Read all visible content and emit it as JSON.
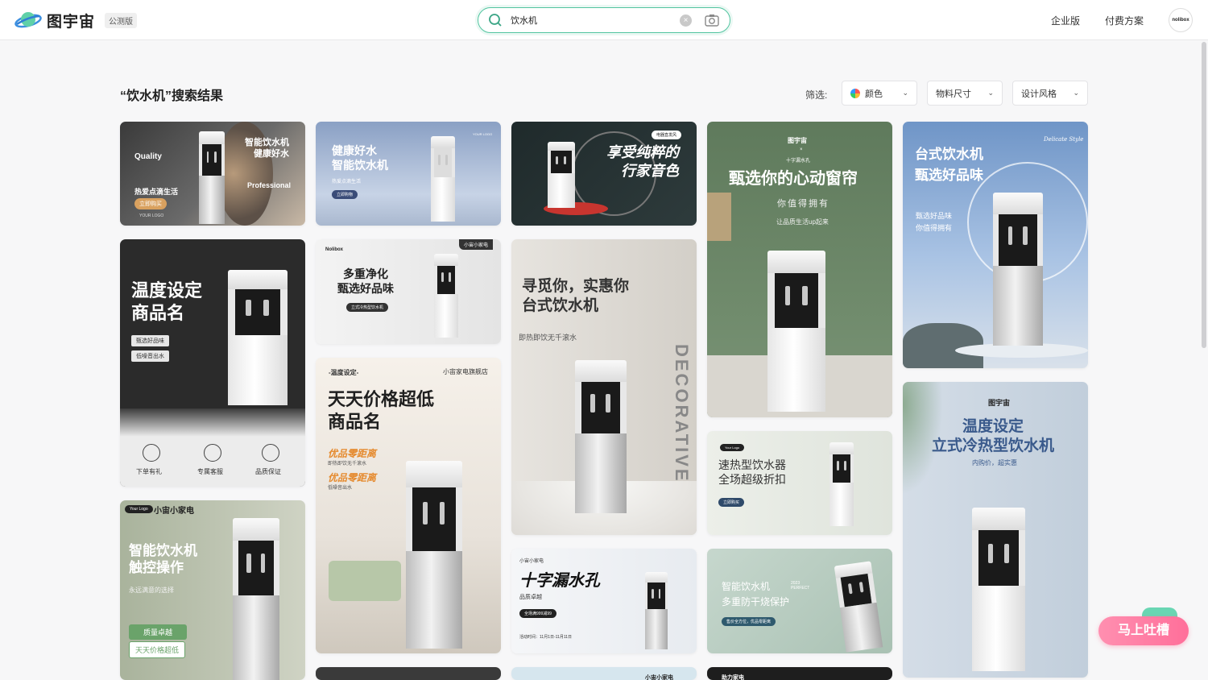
{
  "header": {
    "logo_text": "图宇宙",
    "beta_label": "公测版",
    "search_value": "饮水机",
    "clear_glyph": "×",
    "nav": [
      "企业版",
      "付费方案"
    ],
    "avatar_text": "nolibox"
  },
  "results": {
    "title": "“饮水机”搜索结果",
    "filter_label": "筛选:",
    "filters": [
      "颜色",
      "物料尺寸",
      "设计风格"
    ],
    "chevron": "⌄"
  },
  "cards": [
    {
      "id": 1,
      "title": "智能饮水机\n健康好水",
      "texts": [
        "Quality",
        "Professional",
        "热爱点滴生活"
      ],
      "badge": "立即购买",
      "footer": "YOUR LOGO"
    },
    {
      "id": 2,
      "title": "健康好水\n智能饮水机",
      "texts": [
        "热爱点滴生活"
      ],
      "badge": "立即购物",
      "footer": "YOUR LOGO"
    },
    {
      "id": 3,
      "title": "享受纯粹的\n行家音色",
      "badge": "电器直发风"
    },
    {
      "id": 4,
      "title": "甄选你的心动窗帘",
      "texts": [
        "图宇宙",
        "×",
        "十字漏水孔",
        "你值得拥有",
        "让品质生活up起来"
      ]
    },
    {
      "id": 5,
      "title": "台式饮水机\n甄选好品味",
      "texts": [
        "Delicate Style",
        "甄选好品味",
        "你值得拥有"
      ]
    },
    {
      "id": 6,
      "title": "温度设定\n商品名",
      "texts": [
        "甄选好品味",
        "低噪音出水"
      ],
      "icons": [
        "下单有礼",
        "专属客服",
        "品质保证"
      ]
    },
    {
      "id": 7,
      "title": "多重净化\n甄选好品味",
      "texts": [
        "Nolibox",
        "小宙小家电"
      ],
      "badge": "立式冷热型饮水机"
    },
    {
      "id": 8,
      "title": "寻觅你，实惠你\n台式饮水机",
      "texts": [
        "即热即饮无千滚水",
        "DECORATIVE"
      ]
    },
    {
      "id": 9,
      "title": "速热型饮水器\n全场超级折扣",
      "texts": [
        "Your Logo"
      ],
      "badge": "立即购买"
    },
    {
      "id": 10,
      "title": "温度设定\n立式冷热型饮水机",
      "texts": [
        "图宇宙",
        "内购价，超实惠"
      ]
    },
    {
      "id": 11,
      "title": "天天价格超低\n商品名",
      "texts": [
        "-温度设定-",
        "小宙家电旗舰店",
        "优品零距离",
        "即热即饮无千滚水",
        "优品零距离",
        "低噪音出水"
      ]
    },
    {
      "id": 12,
      "title": "智能饮水机\n触控操作",
      "texts": [
        "Your Logo",
        "小宙小家电",
        "永远满意的选择",
        "质量卓越",
        "天天价格超低"
      ]
    },
    {
      "id": 13,
      "title": "十字漏水孔",
      "texts": [
        "小宙小家电",
        "品质卓越",
        "全场满999减99",
        "活动时间：11月1日-11月11日"
      ]
    },
    {
      "id": 14,
      "title": "智能饮水机\n多重防干烧保护",
      "texts": [
        "2023 PERFECT",
        "售价全方位，优品零距离"
      ]
    },
    {
      "id": 15,
      "title": "",
      "texts": [
        "小宙小家电"
      ]
    },
    {
      "id": 16,
      "title": "",
      "texts": [
        "助力家电"
      ]
    }
  ],
  "feedback": {
    "label": "马上吐槽"
  },
  "colors": {
    "accent": "#52c4a0",
    "feedback": "#ff7aa2"
  }
}
